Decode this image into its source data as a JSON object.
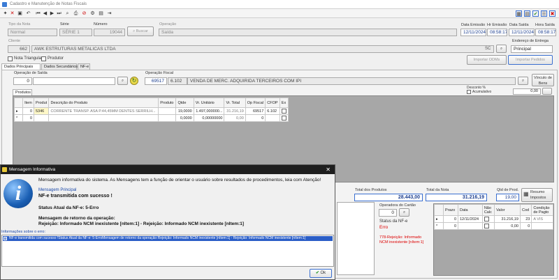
{
  "window": {
    "title": "Cadastro e Manutenção de Notas Fiscais"
  },
  "header": {
    "tipo_nota_label": "Tipo da Nota",
    "tipo_nota_value": "Normal",
    "serie_label": "Série",
    "serie_value": "SÉRIE 1",
    "numero_label": "Número",
    "numero_value": "19044",
    "buscar_label": "Buscar",
    "operacao_label": "Operação",
    "operacao_value": "Saída",
    "data_emissao_label": "Data Emissão",
    "data_emissao_value": "12/11/2024",
    "hr_emissao_label": "Hr Emissão",
    "hr_emissao_value": "08:58:17",
    "data_saida_label": "Data Saída",
    "data_saida_value": "12/11/2024",
    "hora_saida_label": "Hora Saída",
    "hora_saida_value": "08:58:17",
    "cliente_label": "Cliente",
    "cliente_code": "662",
    "cliente_name": "AWK ESTRUTURAS METALICAS LTDA",
    "cliente_uf": "SC",
    "endereco_label": "Endereço de Entrega",
    "endereco_value": "Principal",
    "nota_triangular_label": "Nota Triangular",
    "produtor_label": "Produtor",
    "importar_odms_label": "Importar ODMs",
    "importar_pedidos_label": "Importar Pedidos"
  },
  "tabs": [
    "Dados Principais",
    "Dados Secundários",
    "NF-e"
  ],
  "main": {
    "operacao_saida_label": "Operação de Saída",
    "operacao_saida_value": "0",
    "operacao_fiscal_label": "Operação Fiscal",
    "operacao_fiscal_code": "69517",
    "operacao_fiscal_cfop": "6.102",
    "operacao_fiscal_desc": "VENDA DE MERC. ADQUIRIDA TERCEIROS COM IPI",
    "vinculo_label": "Vínculo de Bens",
    "desconto_label": "Desconto %",
    "acumulativo_label": "Acumulativo",
    "desconto_value": "0,00",
    "produtos_tab": "Produtos"
  },
  "products_table": {
    "headers": [
      "Item",
      "Produt",
      "Descrição do Produto",
      "Produto",
      "Qtde",
      "Vr. Unitário",
      "Vr. Total",
      "Op Fiscal",
      "CFOP",
      "Ex"
    ],
    "rows": [
      [
        "0",
        "5346",
        "CORRENTE TRANSP. ASA P.44,45MM DENTES SERRILH...",
        "",
        "19,0000",
        "1.497,000000...",
        "31.216,19",
        "69517",
        "6.102",
        ""
      ],
      [
        "0",
        "",
        "",
        "",
        "0,0000",
        "0,00000000",
        "0,00",
        "0",
        "",
        ""
      ]
    ]
  },
  "totals": {
    "total_produtos_label": "Total dos Produtos",
    "total_produtos_value": "28.443,00",
    "total_nota_label": "Total da Nota",
    "total_nota_value": "31.216,19",
    "qtd_prod_label": "Qtd de Prod.",
    "qtd_prod_value": "19,00",
    "resumo_label": "Resumo Impostos"
  },
  "lower": {
    "operadora_label": "Operadora do Cartão",
    "operadora_value": "0",
    "status_nfe_label": "Status da NF-e",
    "status_nfe_value": "Erro",
    "status_msg": "778-Rejeição: Informado NCM inexistente [nItem:1]"
  },
  "payments_table": {
    "headers": [
      "Prazo",
      "Data",
      "Não Calc",
      "Valor",
      "Cod",
      "Condição de Pagto"
    ],
    "rows": [
      [
        "0",
        "12/11/2024",
        "",
        "31.216,19",
        "23",
        "A VIS"
      ],
      [
        "0",
        "",
        "",
        "0,00",
        "0",
        ""
      ]
    ]
  },
  "dialog": {
    "title": "Mensagem Informativa",
    "intro": "Mensagem informativa do sistema. As Mensagens tem a função de orientar o usuário sobre resultados de procedimentos, leia com Atenção!",
    "principal_label": "Mensagem Principal",
    "principal_text": "NF-e transmitida com sucesso !",
    "status_text": "Status Atual da NF-e: 5-Erro",
    "retorno_label": "Mensagem de retorno da operação:",
    "retorno_text": "Rejeição: Informado NCM inexistente [nItem:1] - Rejeição: Informado NCM inexistente [nItem:1]",
    "info_label": "Informações sobre o erro:",
    "info_text": "NF-e transmitida com sucesso !Status Atual da NF-e: 5-ErroMensagem de retorno da operação:Rejeição: Informado NCM inexistente [nItem:1] - Rejeição: Informado NCM inexistente [nItem:1]",
    "ok_label": "Ok"
  }
}
